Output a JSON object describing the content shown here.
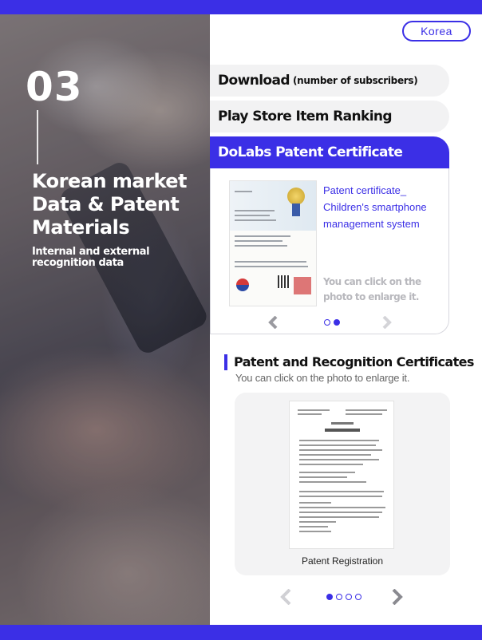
{
  "hero": {
    "number": "03",
    "title": "Korean market Data & Patent Materials",
    "subtitle": "Internal and external recognition data"
  },
  "language_button": "Korea",
  "accordion": {
    "tabs": [
      {
        "label": "Download",
        "suffix": "(number of subscribers)"
      },
      {
        "label": "Play Store Item Ranking"
      },
      {
        "label": "DoLabs Patent Certificate"
      }
    ],
    "active_index": 2,
    "active_content": {
      "caption": "Patent certificate_ Children's smartphone management system",
      "hint": "You can click on the photo to enlarge it.",
      "pagination": {
        "total": 2,
        "current": 2
      }
    }
  },
  "certificates_section": {
    "title": "Patent and Recognition Certificates",
    "subtitle": "You can click on the photo to enlarge it.",
    "slide_caption": "Patent Registration",
    "pagination": {
      "total": 4,
      "current": 1
    }
  },
  "colors": {
    "accent": "#3b2fe6",
    "tab_bg": "#f2f2f3",
    "hint_text": "#b8b8bd"
  },
  "icons": [
    "chevron-left-icon",
    "chevron-right-icon"
  ]
}
